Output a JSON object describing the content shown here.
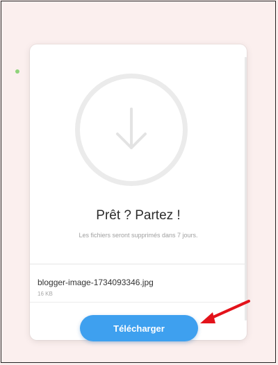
{
  "card": {
    "headline": "Prêt ? Partez !",
    "subtitle": "Les fichiers seront supprimés dans 7 jours.",
    "file_name": "blogger-image-1734093346.jpg",
    "file_size": "16 KB",
    "download_label": "Télécharger"
  },
  "icons": {
    "download": "download-arrow-icon",
    "pointer": "red-arrow-annotation"
  },
  "colors": {
    "background": "#fbefee",
    "button": "#3ea0ef",
    "annotation": "#e3121a"
  }
}
